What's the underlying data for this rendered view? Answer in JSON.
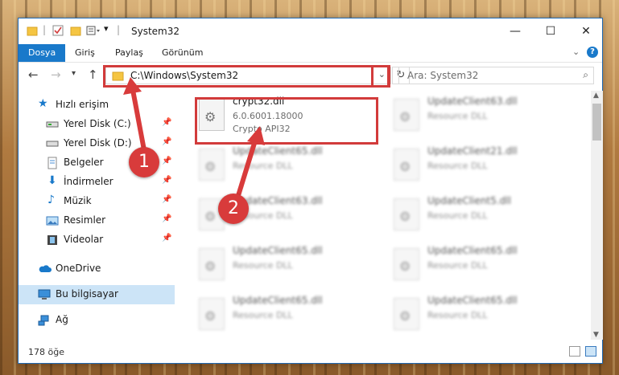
{
  "window": {
    "title": "System32"
  },
  "ribbon": {
    "tabs": [
      "Dosya",
      "Giriş",
      "Paylaş",
      "Görünüm"
    ]
  },
  "nav": {
    "address": "C:\\Windows\\System32",
    "search_placeholder": "Ara: System32"
  },
  "sidebar": {
    "items": [
      {
        "label": "Hızlı erişim",
        "icon": "star-icon"
      },
      {
        "label": "Yerel Disk (C:)",
        "icon": "drive-icon"
      },
      {
        "label": "Yerel Disk (D:)",
        "icon": "drive-icon"
      },
      {
        "label": "Belgeler",
        "icon": "documents-icon"
      },
      {
        "label": "İndirmeler",
        "icon": "download-icon"
      },
      {
        "label": "Müzik",
        "icon": "music-icon"
      },
      {
        "label": "Resimler",
        "icon": "pictures-icon"
      },
      {
        "label": "Videolar",
        "icon": "videos-icon"
      },
      {
        "label": "OneDrive",
        "icon": "cloud-icon"
      },
      {
        "label": "Bu bilgisayar",
        "icon": "computer-icon"
      },
      {
        "label": "Ağ",
        "icon": "network-icon"
      }
    ]
  },
  "files": [
    {
      "name": "crypt32.dll",
      "line2": "6.0.6001.18000",
      "line3": "Crypto API32"
    },
    {
      "name": "UpdateClient63.dll",
      "line2": "Resource DLL",
      "line3": ""
    },
    {
      "name": "UpdateClient65.dll",
      "line2": "Resource DLL",
      "line3": ""
    },
    {
      "name": "UpdateClient21.dll",
      "line2": "Resource DLL",
      "line3": ""
    },
    {
      "name": "UpdateClient63.dll",
      "line2": "Resource DLL",
      "line3": ""
    },
    {
      "name": "UpdateClient5.dll",
      "line2": "Resource DLL",
      "line3": ""
    },
    {
      "name": "UpdateClient65.dll",
      "line2": "Resource DLL",
      "line3": ""
    },
    {
      "name": "UpdateClient65.dll",
      "line2": "Resource DLL",
      "line3": ""
    },
    {
      "name": "UpdateClient65.dll",
      "line2": "Resource DLL",
      "line3": ""
    },
    {
      "name": "UpdateClient65.dll",
      "line2": "Resource DLL",
      "line3": ""
    }
  ],
  "status": {
    "count": "178 öğe"
  },
  "markers": {
    "one": "1",
    "two": "2"
  },
  "colors": {
    "accent": "#1979ca",
    "annotation": "#d23b3b",
    "selected": "#cce4f7"
  }
}
